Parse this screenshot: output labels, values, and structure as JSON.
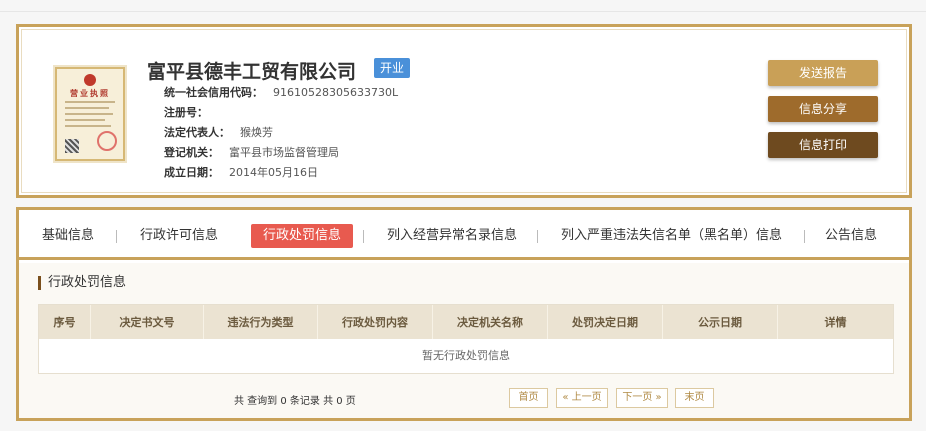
{
  "company": {
    "name": "富平县德丰工贸有限公司",
    "status": "开业",
    "fields": [
      {
        "label": "统一社会信用代码：",
        "value": "91610528305633730L"
      },
      {
        "label": "注册号：",
        "value": ""
      },
      {
        "label": "法定代表人：",
        "value": "猴焕芳"
      },
      {
        "label": "登记机关：",
        "value": "富平县市场监督管理局"
      },
      {
        "label": "成立日期：",
        "value": "2014年05月16日"
      }
    ],
    "license_title": "营业执照"
  },
  "actions": {
    "report": "发送报告",
    "share": "信息分享",
    "print": "信息打印"
  },
  "tabs": [
    {
      "label": "基础信息"
    },
    {
      "label": "行政许可信息"
    },
    {
      "label": "行政处罚信息",
      "active": true
    },
    {
      "label": "列入经营异常名录信息"
    },
    {
      "label": "列入严重违法失信名单（黑名单）信息"
    },
    {
      "label": "公告信息"
    }
  ],
  "section": {
    "title": "行政处罚信息",
    "columns": [
      "序号",
      "决定书文号",
      "违法行为类型",
      "行政处罚内容",
      "决定机关名称",
      "处罚决定日期",
      "公示日期",
      "详情"
    ],
    "empty_text": "暂无行政处罚信息"
  },
  "pager": {
    "summary": "共 查询到 0 条记录 共 0 页",
    "first": "首页",
    "prev": "« 上一页",
    "next": "下一页 »",
    "last": "末页"
  },
  "colors": {
    "border_gold": "#c8a25a",
    "badge_blue": "#4a90d9",
    "active_tab_red": "#e85a4f",
    "btn_report": "#c9a057",
    "btn_share": "#9e6b2c",
    "btn_print": "#6e4a1f"
  }
}
